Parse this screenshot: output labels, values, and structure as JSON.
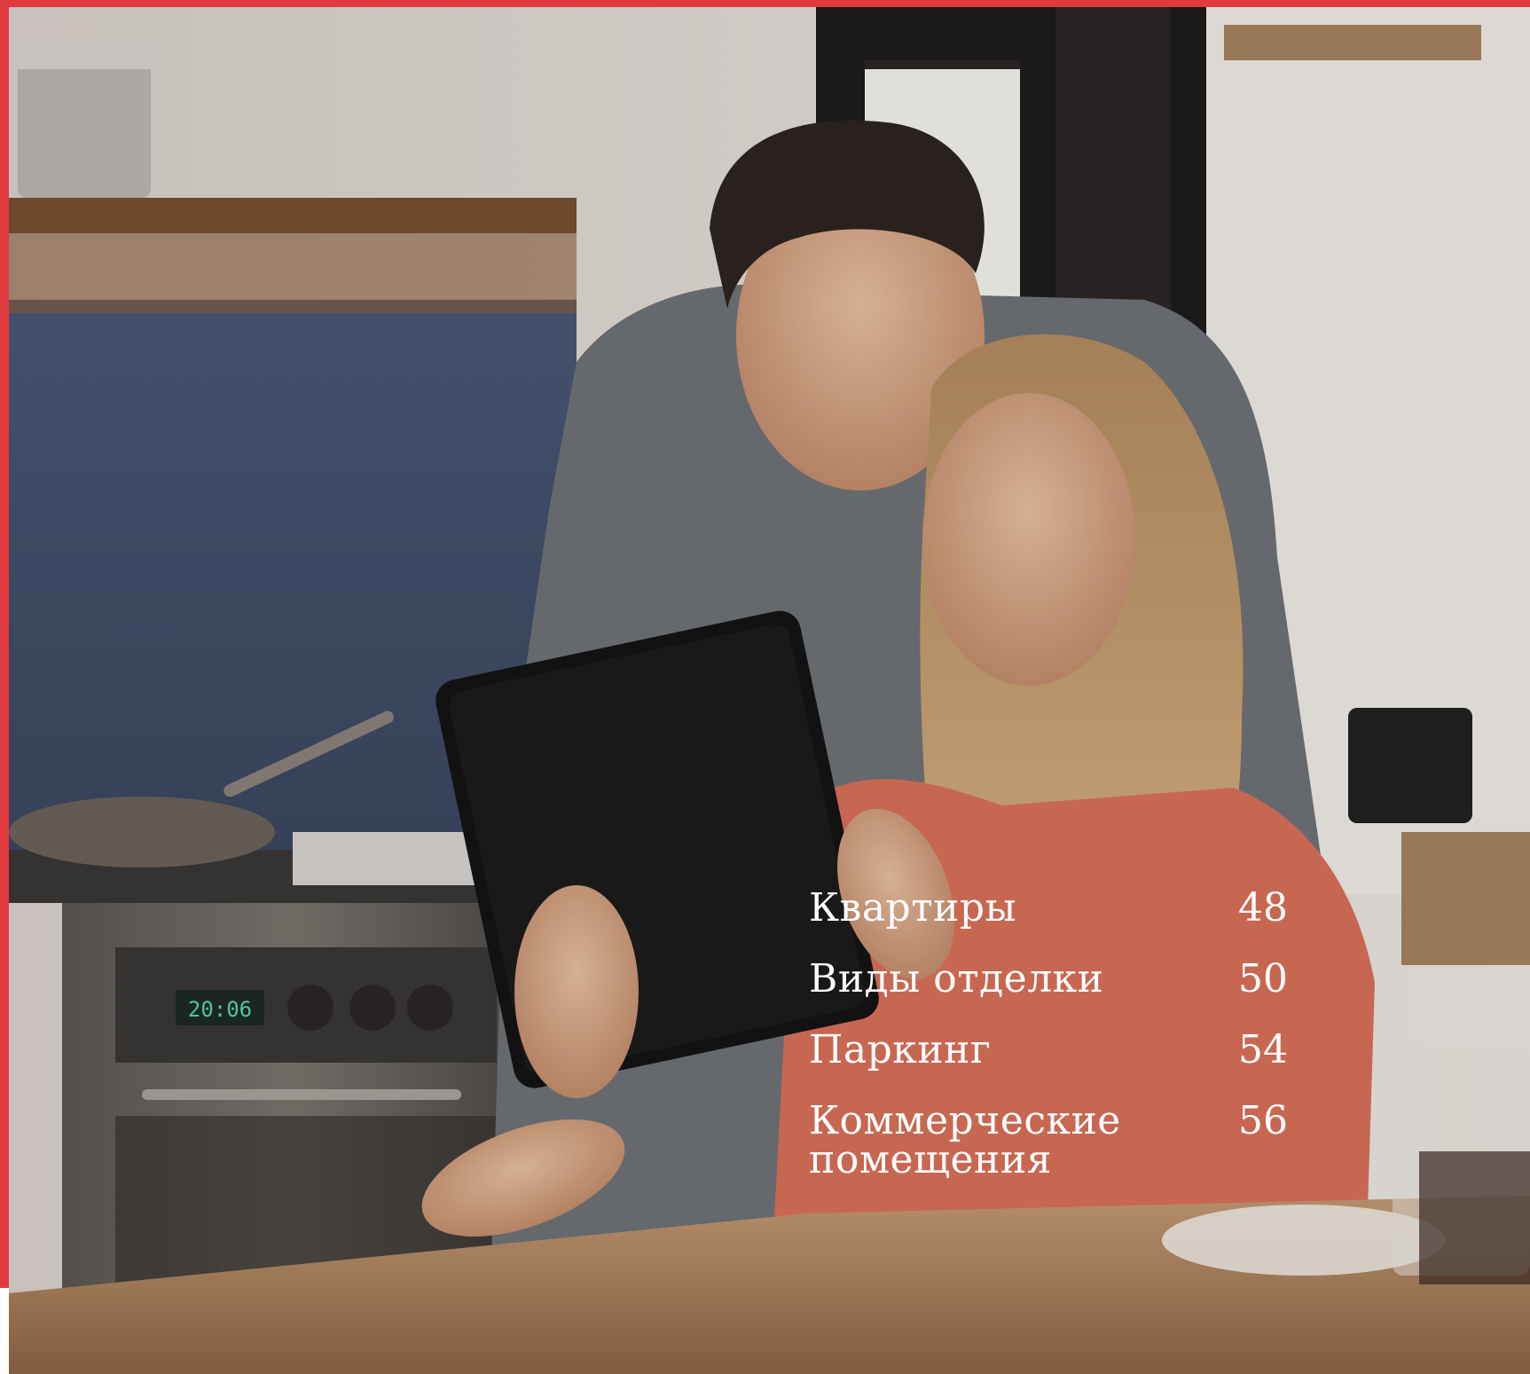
{
  "toc": {
    "items": [
      {
        "title": "Квартиры",
        "page": "48"
      },
      {
        "title": "Виды отделки",
        "page": "50"
      },
      {
        "title": "Паркинг",
        "page": "54"
      },
      {
        "title": "Коммерческие помещения",
        "page": "56"
      }
    ]
  },
  "photo": {
    "oven_clock": "20:06"
  },
  "colors": {
    "accent": "#e03a3e",
    "text": "#ffffff"
  }
}
